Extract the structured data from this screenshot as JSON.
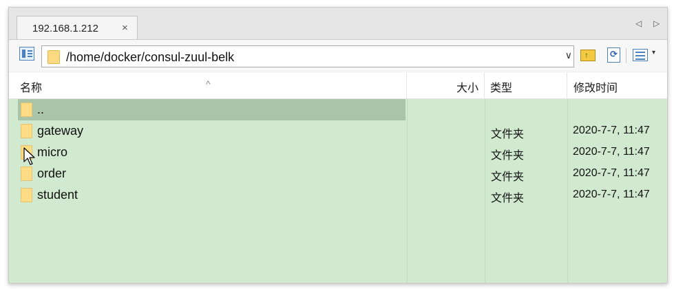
{
  "tab": {
    "title": "192.168.1.212",
    "close": "×"
  },
  "nav": {
    "left": "◁",
    "right": "▷"
  },
  "path": {
    "value": "/home/docker/consul-zuul-belk",
    "dropdown": "∨"
  },
  "toolbar": {
    "view_caret": "▾"
  },
  "columns": {
    "name": "名称",
    "size": "大小",
    "type": "类型",
    "modified": "修改时间",
    "sort_indicator": "^"
  },
  "rows": [
    {
      "name": "..",
      "type": "",
      "modified": "",
      "selected": true
    },
    {
      "name": "gateway",
      "type": "文件夹",
      "modified": "2020-7-7, 11:47"
    },
    {
      "name": "micro",
      "type": "文件夹",
      "modified": "2020-7-7, 11:47"
    },
    {
      "name": "order",
      "type": "文件夹",
      "modified": "2020-7-7, 11:47"
    },
    {
      "name": "student",
      "type": "文件夹",
      "modified": "2020-7-7, 11:47"
    }
  ],
  "colors": {
    "list_bg": "#d0e9cf",
    "selected_row": "#a9c4a7",
    "folder": "#fddc85"
  }
}
